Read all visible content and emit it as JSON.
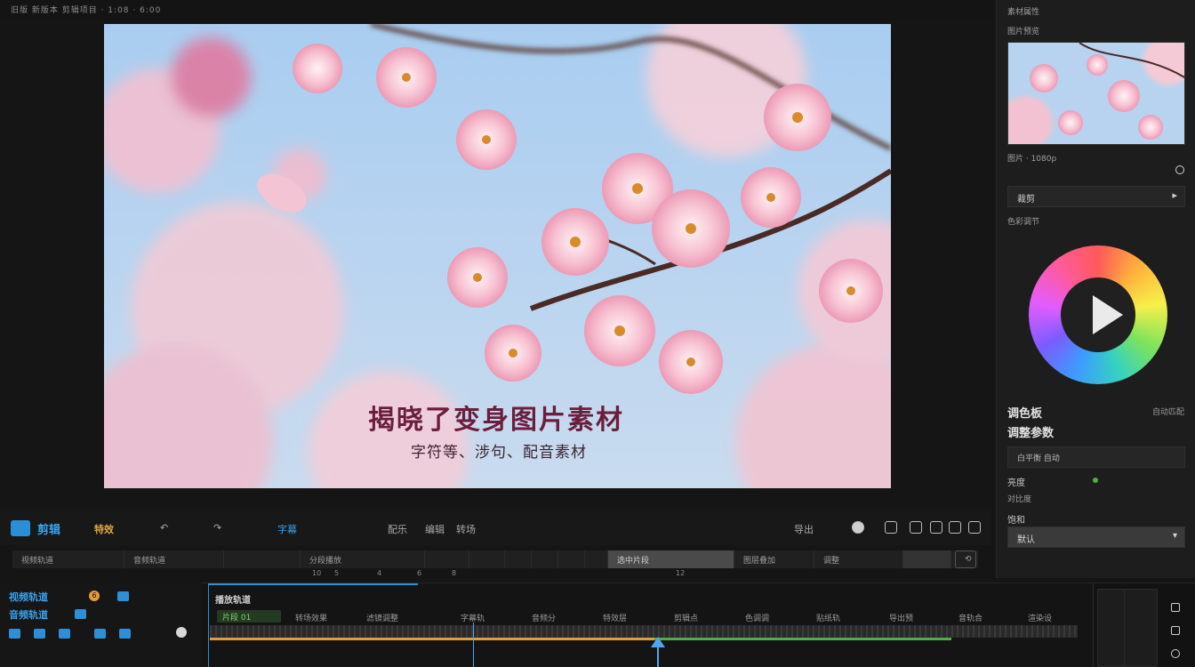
{
  "topbar": {
    "title": "旧版 新版本 剪辑项目 · 1:08 · 6:00"
  },
  "preview": {
    "caption_main": "揭晓了变身图片素材",
    "caption_sub": "字符等、涉句、配音素材"
  },
  "right_panel": {
    "header": "素材属性",
    "subheader": "图片预览",
    "meta": "图片 · 1080p",
    "dropdown_label": "裁剪",
    "section_label": "色彩调节",
    "play_icon": "play-icon",
    "heading1": "调色板",
    "heading1_side": "自动匹配",
    "heading2": "调整参数",
    "field1": "白平衡 自动",
    "row1_label": "亮度",
    "row2_label": "对比度",
    "row3_label": "饱和",
    "select_value": "默认"
  },
  "toolbar": {
    "title": "剪辑",
    "accent_label": "特效",
    "items": [
      "字幕",
      "配乐",
      "编辑",
      "转场",
      "导出"
    ]
  },
  "strip": {
    "segments": [
      "视频轨道",
      "音频轨道",
      "",
      "分段播放",
      "",
      "",
      "",
      "",
      "",
      "选中片段",
      "图层叠加",
      "",
      "调整",
      ""
    ],
    "numbers": [
      "10",
      "5",
      "4",
      "6",
      "8",
      "12"
    ]
  },
  "bottom_left": {
    "row1": "视频轨道",
    "row2": "音频轨道",
    "badge": "6"
  },
  "timeline": {
    "title": "播放轨道",
    "green_label": "片段 01",
    "labels": [
      "转场效果",
      "滤镜调整",
      "字幕轨",
      "音频分",
      "特效层",
      "剪辑点",
      "色调调",
      "贴纸轨",
      "导出预",
      "音轨合",
      "渲染设"
    ]
  },
  "colors": {
    "accent_blue": "#2f8fd6",
    "accent_orange": "#e59a3c",
    "accent_green": "#4fae46",
    "caption": "#6b1e3c"
  }
}
